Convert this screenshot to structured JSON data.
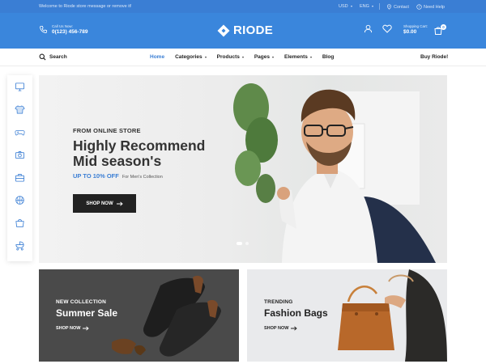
{
  "colors": {
    "brand": "#3a86dc",
    "topbar": "#3a7ed4",
    "dark_button": "#222222",
    "accent_text": "#3a7ed4"
  },
  "topbar": {
    "welcome": "Welcome to Riode store message or remove it!",
    "currency": "USD",
    "language": "ENG",
    "contact": "Contact",
    "help": "Need Help"
  },
  "header": {
    "call_label": "Call Us Now:",
    "phone": "0(123) 456-789",
    "logo_text": "RIODE",
    "cart_label": "Shopping Cart:",
    "cart_total": "$0.00",
    "cart_count": "0",
    "icons": [
      "phone-icon",
      "user-icon",
      "heart-icon",
      "cart-icon"
    ]
  },
  "nav": {
    "search_label": "Search",
    "items": [
      {
        "label": "Home",
        "active": true,
        "dropdown": false
      },
      {
        "label": "Categories",
        "active": false,
        "dropdown": true
      },
      {
        "label": "Products",
        "active": false,
        "dropdown": true
      },
      {
        "label": "Pages",
        "active": false,
        "dropdown": true
      },
      {
        "label": "Elements",
        "active": false,
        "dropdown": true
      },
      {
        "label": "Blog",
        "active": false,
        "dropdown": false
      }
    ],
    "buy_label": "Buy Riode!"
  },
  "sidebar": {
    "icons": [
      "monitor-icon",
      "tshirt-icon",
      "gamepad-icon",
      "camera-icon",
      "briefcase-icon",
      "basketball-icon",
      "bag-icon",
      "stroller-icon"
    ]
  },
  "hero": {
    "eyebrow": "FROM ONLINE STORE",
    "headline_line1": "Highly Recommend",
    "headline_line2": "Mid season's",
    "offer": "UP TO 10% OFF",
    "offer_sub": "For Men's Collection",
    "button": "SHOP NOW",
    "slides_total": 2,
    "active_slide": 1
  },
  "banners": [
    {
      "tag": "NEW COLLECTION",
      "title": "Summer Sale",
      "link": "SHOP NOW"
    },
    {
      "tag": "TRENDING",
      "title": "Fashion Bags",
      "link": "SHOP NOW"
    }
  ]
}
